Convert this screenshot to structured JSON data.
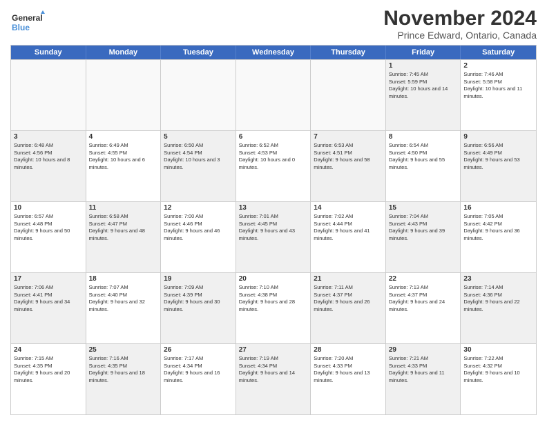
{
  "logo": {
    "line1": "General",
    "line2": "Blue"
  },
  "title": "November 2024",
  "location": "Prince Edward, Ontario, Canada",
  "days_of_week": [
    "Sunday",
    "Monday",
    "Tuesday",
    "Wednesday",
    "Thursday",
    "Friday",
    "Saturday"
  ],
  "rows": [
    [
      {
        "day": "",
        "empty": true,
        "text": ""
      },
      {
        "day": "",
        "empty": true,
        "text": ""
      },
      {
        "day": "",
        "empty": true,
        "text": ""
      },
      {
        "day": "",
        "empty": true,
        "text": ""
      },
      {
        "day": "",
        "empty": true,
        "text": ""
      },
      {
        "day": "1",
        "shaded": true,
        "text": "Sunrise: 7:45 AM\nSunset: 5:59 PM\nDaylight: 10 hours and 14 minutes."
      },
      {
        "day": "2",
        "shaded": false,
        "text": "Sunrise: 7:46 AM\nSunset: 5:58 PM\nDaylight: 10 hours and 11 minutes."
      }
    ],
    [
      {
        "day": "3",
        "shaded": true,
        "text": "Sunrise: 6:48 AM\nSunset: 4:56 PM\nDaylight: 10 hours and 8 minutes."
      },
      {
        "day": "4",
        "shaded": false,
        "text": "Sunrise: 6:49 AM\nSunset: 4:55 PM\nDaylight: 10 hours and 6 minutes."
      },
      {
        "day": "5",
        "shaded": true,
        "text": "Sunrise: 6:50 AM\nSunset: 4:54 PM\nDaylight: 10 hours and 3 minutes."
      },
      {
        "day": "6",
        "shaded": false,
        "text": "Sunrise: 6:52 AM\nSunset: 4:53 PM\nDaylight: 10 hours and 0 minutes."
      },
      {
        "day": "7",
        "shaded": true,
        "text": "Sunrise: 6:53 AM\nSunset: 4:51 PM\nDaylight: 9 hours and 58 minutes."
      },
      {
        "day": "8",
        "shaded": false,
        "text": "Sunrise: 6:54 AM\nSunset: 4:50 PM\nDaylight: 9 hours and 55 minutes."
      },
      {
        "day": "9",
        "shaded": true,
        "text": "Sunrise: 6:56 AM\nSunset: 4:49 PM\nDaylight: 9 hours and 53 minutes."
      }
    ],
    [
      {
        "day": "10",
        "shaded": false,
        "text": "Sunrise: 6:57 AM\nSunset: 4:48 PM\nDaylight: 9 hours and 50 minutes."
      },
      {
        "day": "11",
        "shaded": true,
        "text": "Sunrise: 6:58 AM\nSunset: 4:47 PM\nDaylight: 9 hours and 48 minutes."
      },
      {
        "day": "12",
        "shaded": false,
        "text": "Sunrise: 7:00 AM\nSunset: 4:46 PM\nDaylight: 9 hours and 46 minutes."
      },
      {
        "day": "13",
        "shaded": true,
        "text": "Sunrise: 7:01 AM\nSunset: 4:45 PM\nDaylight: 9 hours and 43 minutes."
      },
      {
        "day": "14",
        "shaded": false,
        "text": "Sunrise: 7:02 AM\nSunset: 4:44 PM\nDaylight: 9 hours and 41 minutes."
      },
      {
        "day": "15",
        "shaded": true,
        "text": "Sunrise: 7:04 AM\nSunset: 4:43 PM\nDaylight: 9 hours and 39 minutes."
      },
      {
        "day": "16",
        "shaded": false,
        "text": "Sunrise: 7:05 AM\nSunset: 4:42 PM\nDaylight: 9 hours and 36 minutes."
      }
    ],
    [
      {
        "day": "17",
        "shaded": true,
        "text": "Sunrise: 7:06 AM\nSunset: 4:41 PM\nDaylight: 9 hours and 34 minutes."
      },
      {
        "day": "18",
        "shaded": false,
        "text": "Sunrise: 7:07 AM\nSunset: 4:40 PM\nDaylight: 9 hours and 32 minutes."
      },
      {
        "day": "19",
        "shaded": true,
        "text": "Sunrise: 7:09 AM\nSunset: 4:39 PM\nDaylight: 9 hours and 30 minutes."
      },
      {
        "day": "20",
        "shaded": false,
        "text": "Sunrise: 7:10 AM\nSunset: 4:38 PM\nDaylight: 9 hours and 28 minutes."
      },
      {
        "day": "21",
        "shaded": true,
        "text": "Sunrise: 7:11 AM\nSunset: 4:37 PM\nDaylight: 9 hours and 26 minutes."
      },
      {
        "day": "22",
        "shaded": false,
        "text": "Sunrise: 7:13 AM\nSunset: 4:37 PM\nDaylight: 9 hours and 24 minutes."
      },
      {
        "day": "23",
        "shaded": true,
        "text": "Sunrise: 7:14 AM\nSunset: 4:36 PM\nDaylight: 9 hours and 22 minutes."
      }
    ],
    [
      {
        "day": "24",
        "shaded": false,
        "text": "Sunrise: 7:15 AM\nSunset: 4:35 PM\nDaylight: 9 hours and 20 minutes."
      },
      {
        "day": "25",
        "shaded": true,
        "text": "Sunrise: 7:16 AM\nSunset: 4:35 PM\nDaylight: 9 hours and 18 minutes."
      },
      {
        "day": "26",
        "shaded": false,
        "text": "Sunrise: 7:17 AM\nSunset: 4:34 PM\nDaylight: 9 hours and 16 minutes."
      },
      {
        "day": "27",
        "shaded": true,
        "text": "Sunrise: 7:19 AM\nSunset: 4:34 PM\nDaylight: 9 hours and 14 minutes."
      },
      {
        "day": "28",
        "shaded": false,
        "text": "Sunrise: 7:20 AM\nSunset: 4:33 PM\nDaylight: 9 hours and 13 minutes."
      },
      {
        "day": "29",
        "shaded": true,
        "text": "Sunrise: 7:21 AM\nSunset: 4:33 PM\nDaylight: 9 hours and 11 minutes."
      },
      {
        "day": "30",
        "shaded": false,
        "text": "Sunrise: 7:22 AM\nSunset: 4:32 PM\nDaylight: 9 hours and 10 minutes."
      }
    ]
  ]
}
